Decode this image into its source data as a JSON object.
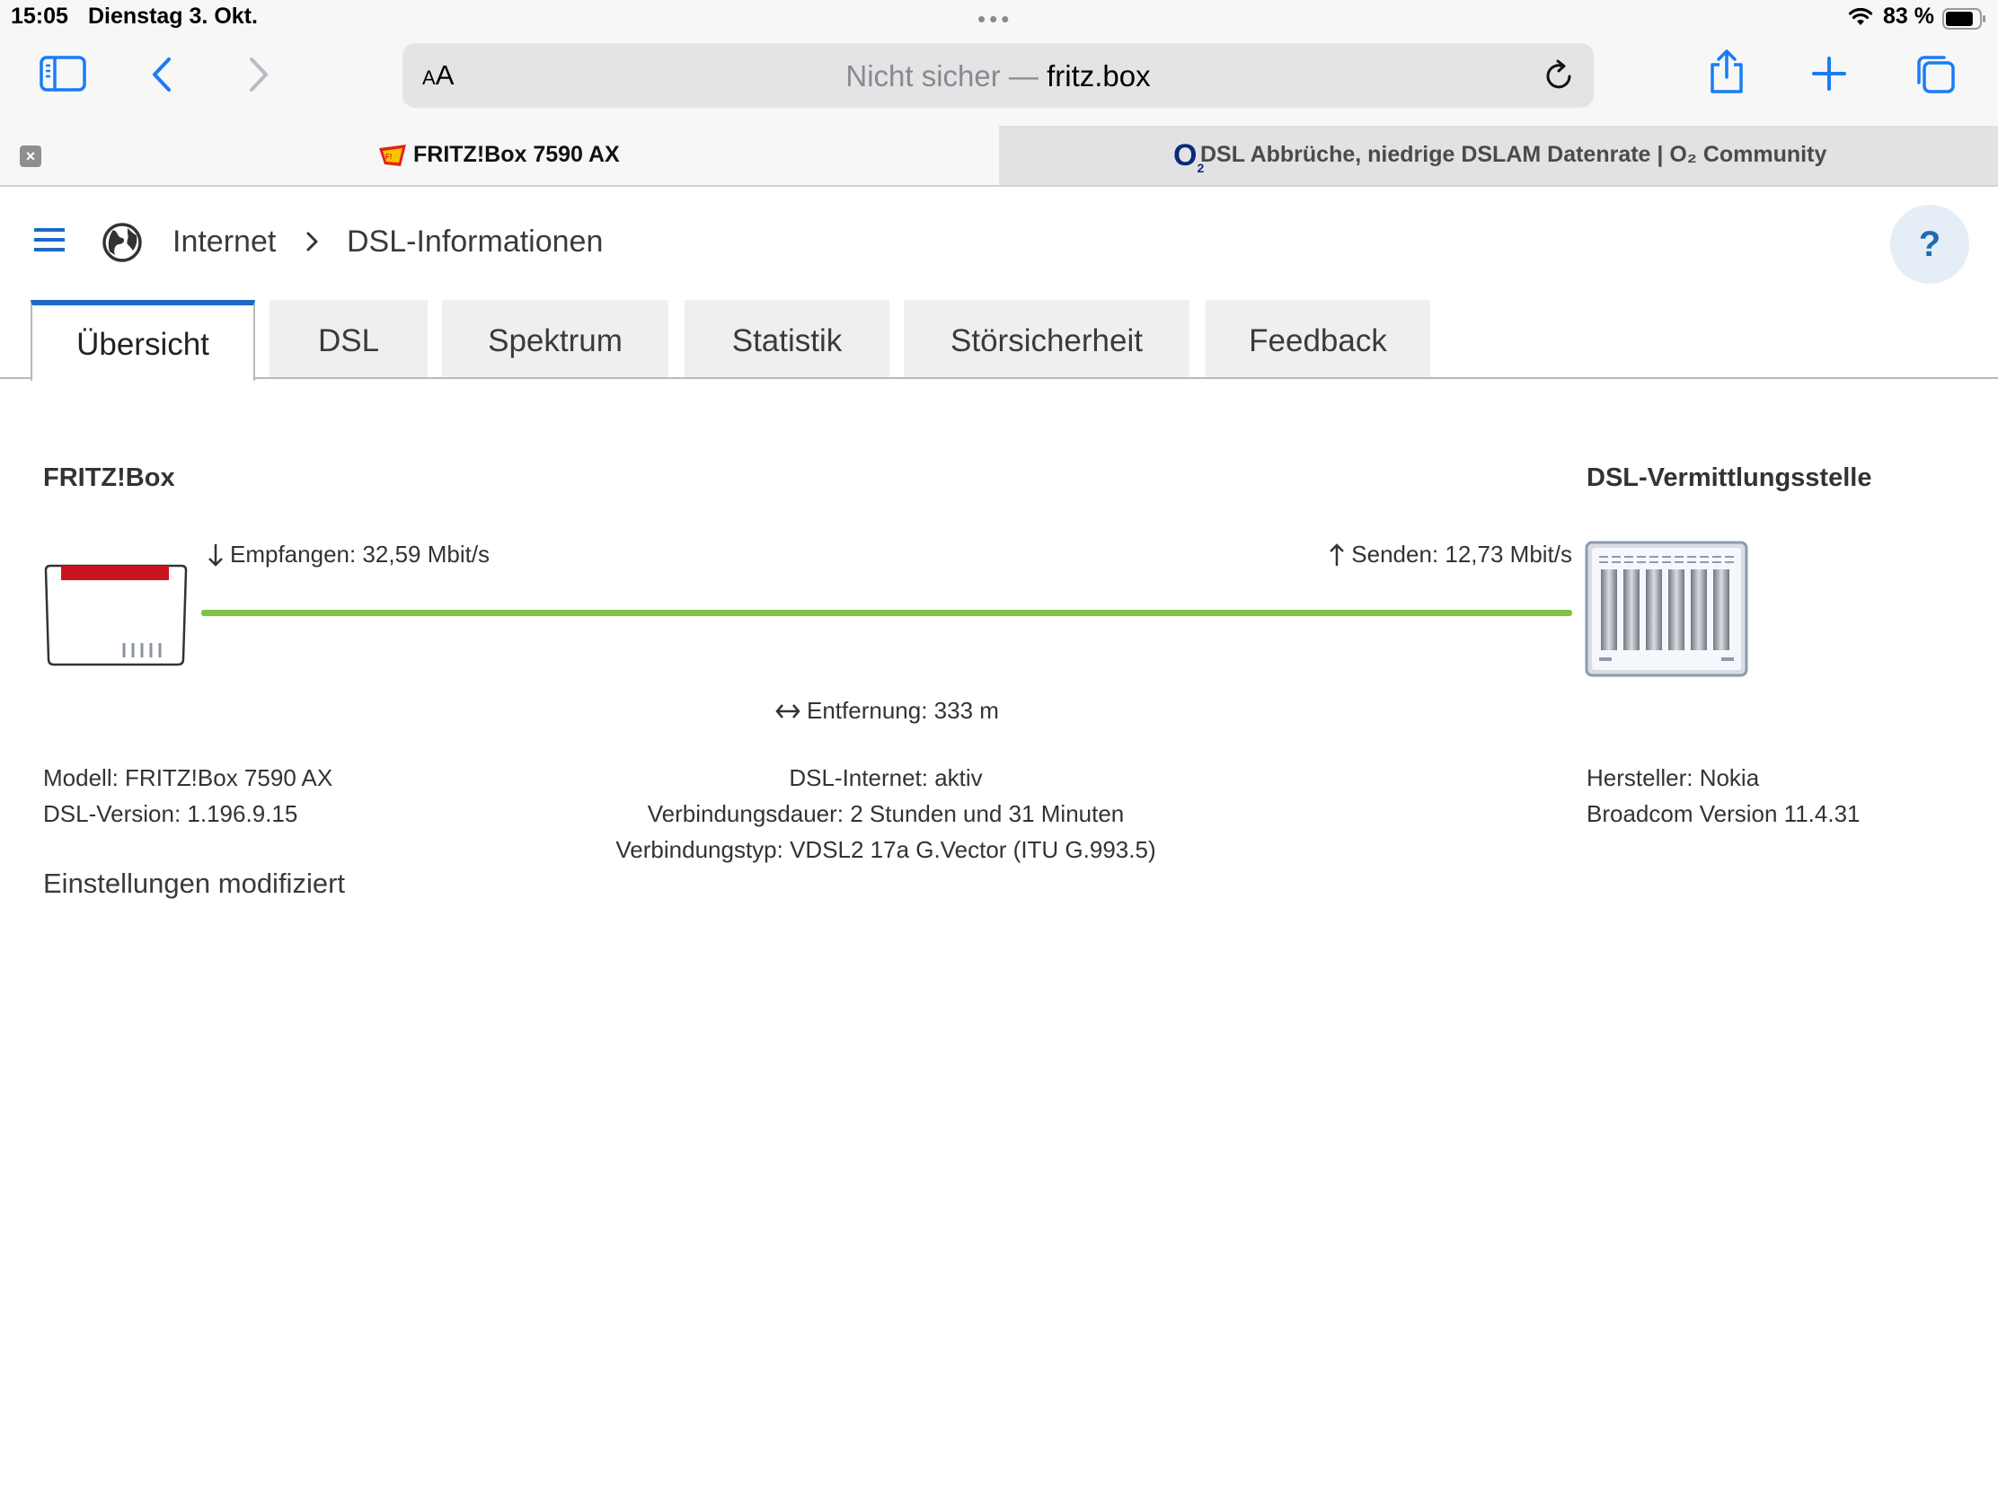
{
  "status_bar": {
    "time": "15:05",
    "date": "Dienstag 3. Okt.",
    "battery_percent": "83 %",
    "battery_level": 0.83
  },
  "browser": {
    "url_prefix": "Nicht sicher — ",
    "url_host": "fritz.box",
    "aa_small": "A",
    "aa_big": "A",
    "tabs": [
      {
        "title": "FRITZ!Box 7590 AX",
        "active": true
      },
      {
        "title": "DSL Abbrüche, niedrige DSLAM Datenrate | O₂ Community",
        "active": false
      }
    ],
    "o2_logo": "O",
    "o2_sub": "2"
  },
  "header": {
    "breadcrumb": [
      "Internet",
      "DSL-Informationen"
    ],
    "help_label": "?"
  },
  "content_tabs": [
    {
      "label": "Übersicht",
      "active": true
    },
    {
      "label": "DSL",
      "active": false
    },
    {
      "label": "Spektrum",
      "active": false
    },
    {
      "label": "Statistik",
      "active": false
    },
    {
      "label": "Störsicherheit",
      "active": false
    },
    {
      "label": "Feedback",
      "active": false
    }
  ],
  "overview": {
    "left_heading": "FRITZ!Box",
    "right_heading": "DSL-Vermittlungsstelle",
    "receive": "Empfangen: 32,59 Mbit/s",
    "send": "Senden: 12,73 Mbit/s",
    "distance": "Entfernung: 333 m",
    "left_info": [
      "Modell: FRITZ!Box 7590 AX",
      "DSL-Version: 1.196.9.15"
    ],
    "center_info": [
      "DSL-Internet: aktiv",
      "Verbindungsdauer: 2 Stunden und 31 Minuten",
      "Verbindungstyp: VDSL2 17a G.Vector (ITU G.993.5)"
    ],
    "right_info": [
      "Hersteller: Nokia",
      "Broadcom Version 11.4.31"
    ],
    "settings_note": "Einstellungen modifiziert",
    "line_color": "#7bc341"
  }
}
